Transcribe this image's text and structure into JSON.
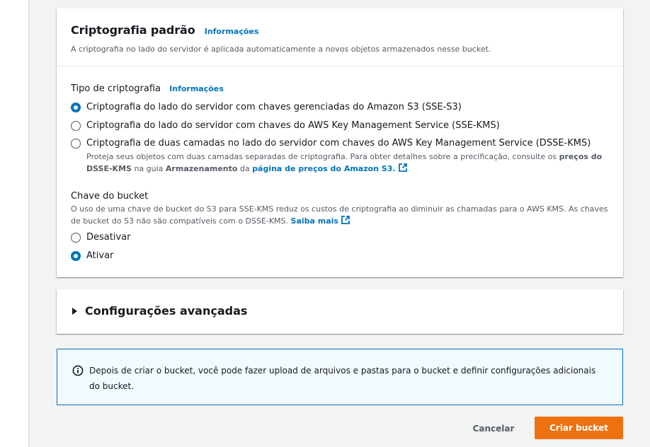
{
  "encryption": {
    "title": "Criptografia padrão",
    "info_link": "Informações",
    "description": "A criptografia no lado do servidor é aplicada automaticamente a novos objetos armazenados nesse bucket.",
    "type_label": "Tipo de criptografia",
    "type_info_link": "Informações",
    "options": [
      {
        "label": "Criptografia do lado do servidor com chaves gerenciadas do Amazon S3 (SSE-S3)",
        "selected": true
      },
      {
        "label": "Criptografia do lado do servidor com chaves do AWS Key Management Service (SSE-KMS)",
        "selected": false
      },
      {
        "label": "Criptografia de duas camadas no lado do servidor com chaves do AWS Key Management Service (DSSE-KMS)",
        "selected": false
      }
    ],
    "dsse_desc": {
      "part1": "Proteja seus objetos com duas camadas separadas de criptografia. Para obter detalhes sobre a precificação, consulte os ",
      "bold1": "preços do DSSE-KMS",
      "part2": " na guia ",
      "bold2": "Armazenamento",
      "part3": " da ",
      "link": "página de preços do Amazon S3."
    },
    "bucket_key": {
      "label": "Chave do bucket",
      "description": "O uso de uma chave de bucket do S3 para SSE-KMS reduz os custos de criptografia ao diminuir as chamadas para o AWS KMS. As chaves de bucket do S3 não são compatíveis com o DSSE-KMS.",
      "learn_more": "Saiba mais",
      "options": [
        {
          "label": "Desativar",
          "selected": false
        },
        {
          "label": "Ativar",
          "selected": true
        }
      ]
    }
  },
  "advanced": {
    "title": "Configurações avançadas"
  },
  "alert": {
    "text": "Depois de criar o bucket, você pode fazer upload de arquivos e pastas para o bucket e definir configurações adicionais do bucket."
  },
  "actions": {
    "cancel": "Cancelar",
    "create": "Criar bucket"
  },
  "icons": {
    "external": "external-link-icon",
    "info": "info-circle-icon",
    "caret": "caret-right-icon"
  },
  "colors": {
    "link": "#0073bb",
    "primary_button": "#ec7211",
    "alert_border": "#0073bb",
    "alert_bg": "#f1faff"
  }
}
